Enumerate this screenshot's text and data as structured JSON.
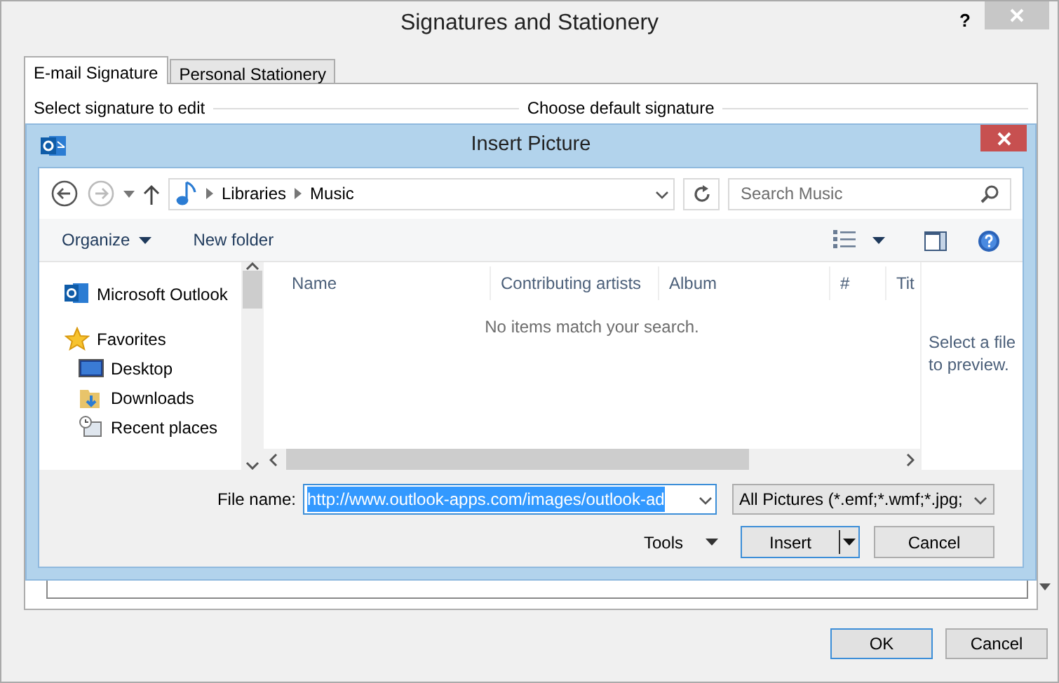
{
  "window": {
    "title": "Signatures and Stationery",
    "help": "?"
  },
  "tabs": [
    {
      "label": "E-mail Signature",
      "selected": true
    },
    {
      "label": "Personal Stationery",
      "selected": false
    }
  ],
  "sections": [
    "Select signature to edit",
    "Choose default signature"
  ],
  "buttons": [
    "OK",
    "Cancel"
  ],
  "insert_dialog": {
    "title": "Insert Picture",
    "breadcrumb": [
      "Libraries",
      "Music"
    ],
    "search": {
      "placeholder": "Search Music"
    },
    "toolbar": [
      "Organize",
      "New folder"
    ],
    "nav": [
      {
        "label": "Microsoft Outlook",
        "kind": "outlook"
      },
      {
        "label": "Favorites",
        "kind": "star",
        "children": [
          {
            "label": "Desktop",
            "kind": "desktop"
          },
          {
            "label": "Downloads",
            "kind": "downloads"
          },
          {
            "label": "Recent places",
            "kind": "recent"
          }
        ]
      }
    ],
    "columns": [
      "Name",
      "Contributing artists",
      "Album",
      "#",
      "Tit"
    ],
    "empty_message": "No items match your search.",
    "preview_message": "Select a file to preview.",
    "file_name": {
      "label": "File name:",
      "value": "http://www.outlook-apps.com/images/outlook-ad"
    },
    "file_type": "All Pictures (*.emf;*.wmf;*.jpg;",
    "tools": "Tools",
    "buttons": [
      "Insert",
      "Cancel"
    ]
  }
}
